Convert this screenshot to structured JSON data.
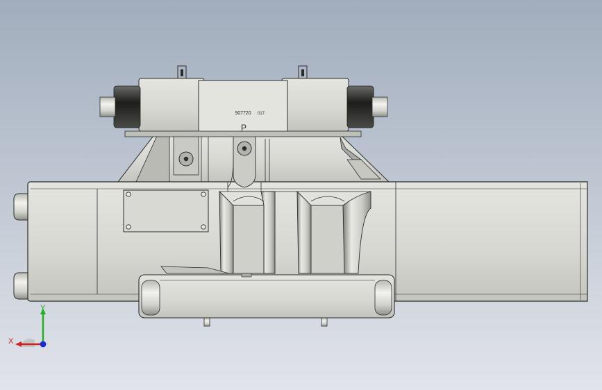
{
  "viewport": {
    "background_top": "#a1adbd",
    "background_bottom": "#e1e4ea",
    "body_color": "#d8d9d3",
    "shade_color": "#a9aaa3",
    "edge_color": "#2a2c2a"
  },
  "model": {
    "engraving_code": "907720",
    "engraving_code_suffix": "017",
    "port_label": "P"
  },
  "triad": {
    "x_label": "X",
    "y_label": "Y",
    "x_color": "#d02020",
    "y_color": "#20b020",
    "z_color": "#1a2bd0"
  }
}
